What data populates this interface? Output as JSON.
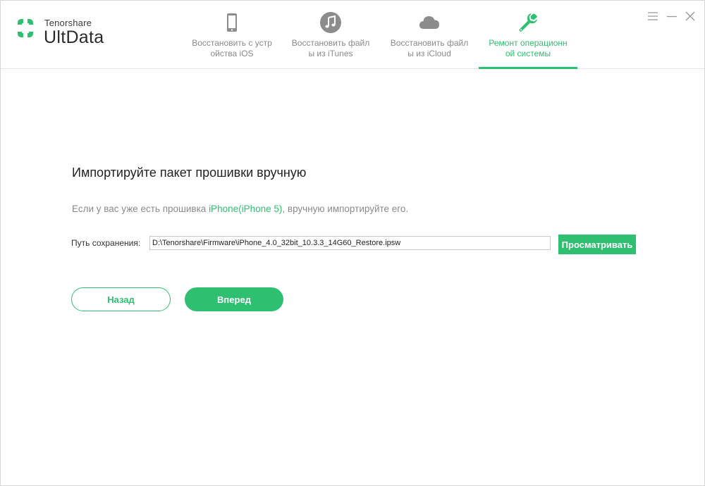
{
  "brand": {
    "company": "Tenorshare",
    "product": "UltData"
  },
  "tabs": [
    {
      "label": "Восстановить с устр\nойства iOS",
      "icon": "phone-icon",
      "active": false
    },
    {
      "label": "Восстановить файл\nы из iTunes",
      "icon": "music-note-icon",
      "active": false
    },
    {
      "label": "Восстановить файл\nы из iCloud",
      "icon": "cloud-icon",
      "active": false
    },
    {
      "label": "Ремонт операционн\nой системы",
      "icon": "wrench-icon",
      "active": true
    }
  ],
  "window_controls": [
    "menu-icon",
    "minimize-icon",
    "close-icon"
  ],
  "main": {
    "title": "Импортируйте пакет прошивки вручную",
    "desc_before": "Если у вас уже есть прошивка ",
    "desc_accent": "iPhone(iPhone 5)",
    "desc_after": ", вручную импортируйте его.",
    "path_label": "Путь сохранения:",
    "path_value": "D:\\Tenorshare\\Firmware\\iPhone_4.0_32bit_10.3.3_14G60_Restore.ipsw",
    "browse_label": "Просматривать",
    "back_label": "Назад",
    "next_label": "Вперед"
  },
  "colors": {
    "accent": "#2fbf71",
    "inactive_tab_text": "#8a8a8a",
    "inactive_icon": "#8c8c8c"
  }
}
